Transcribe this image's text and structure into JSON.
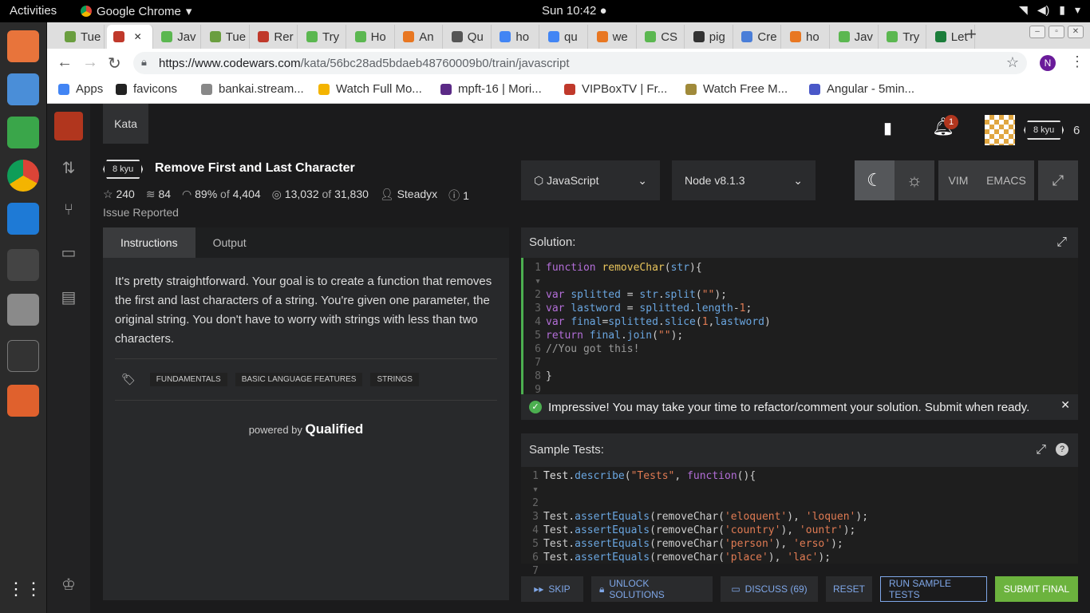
{
  "os": {
    "activities": "Activities",
    "app_name": "Google Chrome",
    "clock": "Sun 10:42 ●"
  },
  "browser": {
    "tabs": [
      "Tue",
      "",
      "Jav",
      "Tue",
      "Rer",
      "Try",
      "Ho",
      "An",
      "Qu",
      "ho",
      "qu",
      "we",
      "CS",
      "pig",
      "Cre",
      "ho",
      "Jav",
      "Try",
      "Let"
    ],
    "active_tab_index": 1,
    "url_domain": "https://www.codewars.com",
    "url_path": "/kata/56bc28ad5bdaeb48760009b0/train/javascript",
    "profile_initial": "N",
    "bookmarks": [
      "Apps",
      "favicons",
      "bankai.stream...",
      "Watch Full Mo...",
      "mpft-16 | Mori...",
      "VIPBoxTV | Fr...",
      "Watch Free M...",
      "Angular - 5min..."
    ]
  },
  "codewars": {
    "kata_tab": "Kata",
    "notification_count": "1",
    "user_rank": "8 kyu",
    "honor": "6",
    "kata_rank": "8 kyu",
    "kata_title": "Remove First and Last Character",
    "stats": {
      "stars": "240",
      "collections": "84",
      "satisfaction": "89%",
      "of1": "of",
      "votes": "4,404",
      "completed": "13,032",
      "of2": "of",
      "attempts": "31,830",
      "author": "Steadyx",
      "issues": "1"
    },
    "issue_label": "Issue Reported",
    "language": "JavaScript",
    "runtime": "Node v8.1.3",
    "modes": [
      "VIM",
      "EMACS"
    ],
    "instr_tabs": [
      "Instructions",
      "Output"
    ],
    "instructions": "It's pretty straightforward. Your goal is to create a function that removes the first and last characters of a string. You're given one parameter, the original string. You don't have to worry with strings with less than two characters.",
    "tags": [
      "FUNDAMENTALS",
      "BASIC LANGUAGE FEATURES",
      "STRINGS"
    ],
    "powered_by": "powered by",
    "qualified": "Qualified",
    "solution_label": "Solution:",
    "success_msg": "Impressive! You may take your time to refactor/comment your solution. Submit when ready.",
    "tests_label": "Sample Tests:",
    "buttons": {
      "skip": "SKIP",
      "unlock": "UNLOCK SOLUTIONS",
      "discuss": "DISCUSS (69)",
      "reset": "RESET",
      "run": "RUN SAMPLE TESTS",
      "submit": "SUBMIT FINAL"
    }
  }
}
